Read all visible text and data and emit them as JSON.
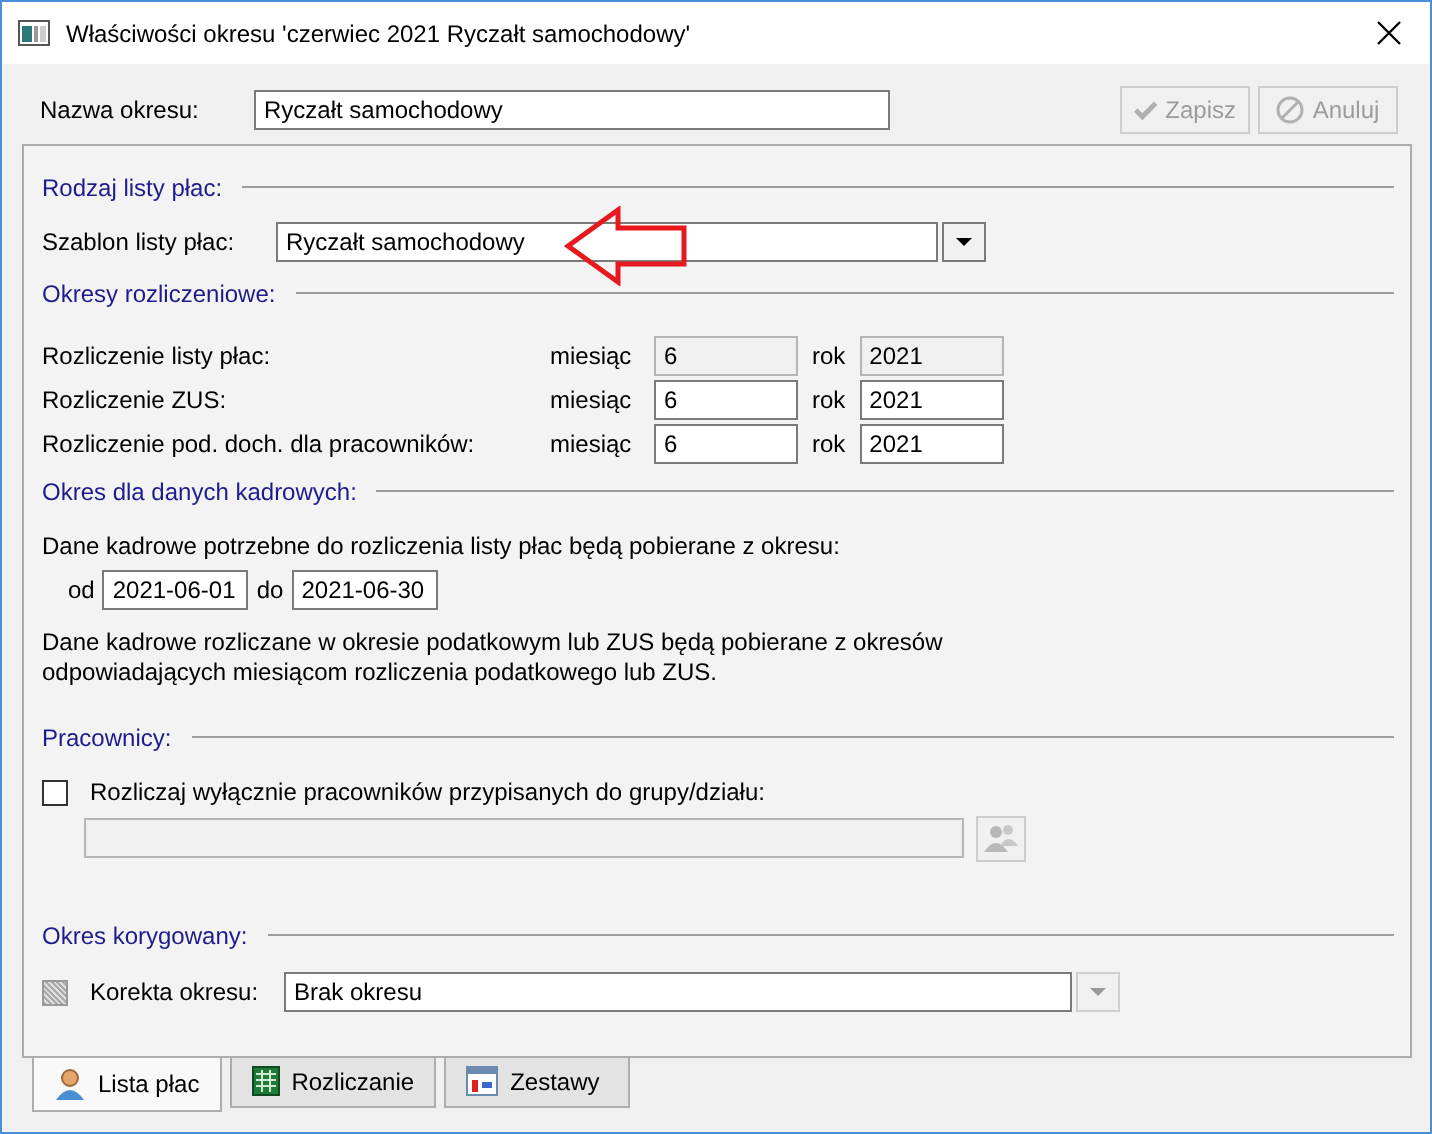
{
  "window": {
    "title": "Właściwości okresu 'czerwiec 2021 Ryczałt samochodowy'"
  },
  "period_name": {
    "label": "Nazwa okresu:",
    "value": "Ryczałt samochodowy"
  },
  "buttons": [
    {
      "label": "Zapisz",
      "kind": "save",
      "disabled": true
    },
    {
      "label": "Anuluj",
      "kind": "cancel",
      "disabled": true
    }
  ],
  "payroll_type": {
    "heading": "Rodzaj listy płac:",
    "label": "Szablon listy płac:",
    "value": "Ryczałt samochodowy"
  },
  "settlement_periods": {
    "heading": "Okresy rozliczeniowe:",
    "rows": [
      {
        "label": "Rozliczenie listy płac:",
        "month_label": "miesiąc",
        "month": "6",
        "year_label": "rok",
        "year": "2021",
        "disabled": true
      },
      {
        "label": "Rozliczenie ZUS:",
        "month_label": "miesiąc",
        "month": "6",
        "year_label": "rok",
        "year": "2021",
        "disabled": false
      },
      {
        "label": "Rozliczenie pod. doch. dla pracowników:",
        "month_label": "miesiąc",
        "month": "6",
        "year_label": "rok",
        "year": "2021",
        "disabled": false
      }
    ]
  },
  "hr_period": {
    "heading": "Okres dla danych kadrowych:",
    "intro": "Dane kadrowe potrzebne do rozliczenia listy płac będą pobierane z okresu:",
    "from_label": "od",
    "from": "2021-06-01",
    "to_label": "do",
    "to": "2021-06-30",
    "note_lines": [
      "Dane kadrowe rozliczane w okresie podatkowym lub ZUS będą pobierane z okresów",
      "odpowiadających miesiącom rozliczenia podatkowego lub ZUS."
    ]
  },
  "employees": {
    "heading": "Pracownicy:",
    "checkbox_label": "Rozliczaj wyłącznie pracowników przypisanych do grupy/działu:",
    "checked": false,
    "group_disabled": true
  },
  "corrected_period": {
    "heading": "Okres korygowany:",
    "checkbox_disabled": true,
    "label": "Korekta okresu:",
    "value": "Brak okresu",
    "dropdown_disabled": true
  },
  "tabs": [
    {
      "label": "Lista płac",
      "kind": "person",
      "selected": true
    },
    {
      "label": "Rozliczanie",
      "kind": "sheet",
      "selected": false
    },
    {
      "label": "Zestawy",
      "kind": "report",
      "selected": false
    }
  ]
}
